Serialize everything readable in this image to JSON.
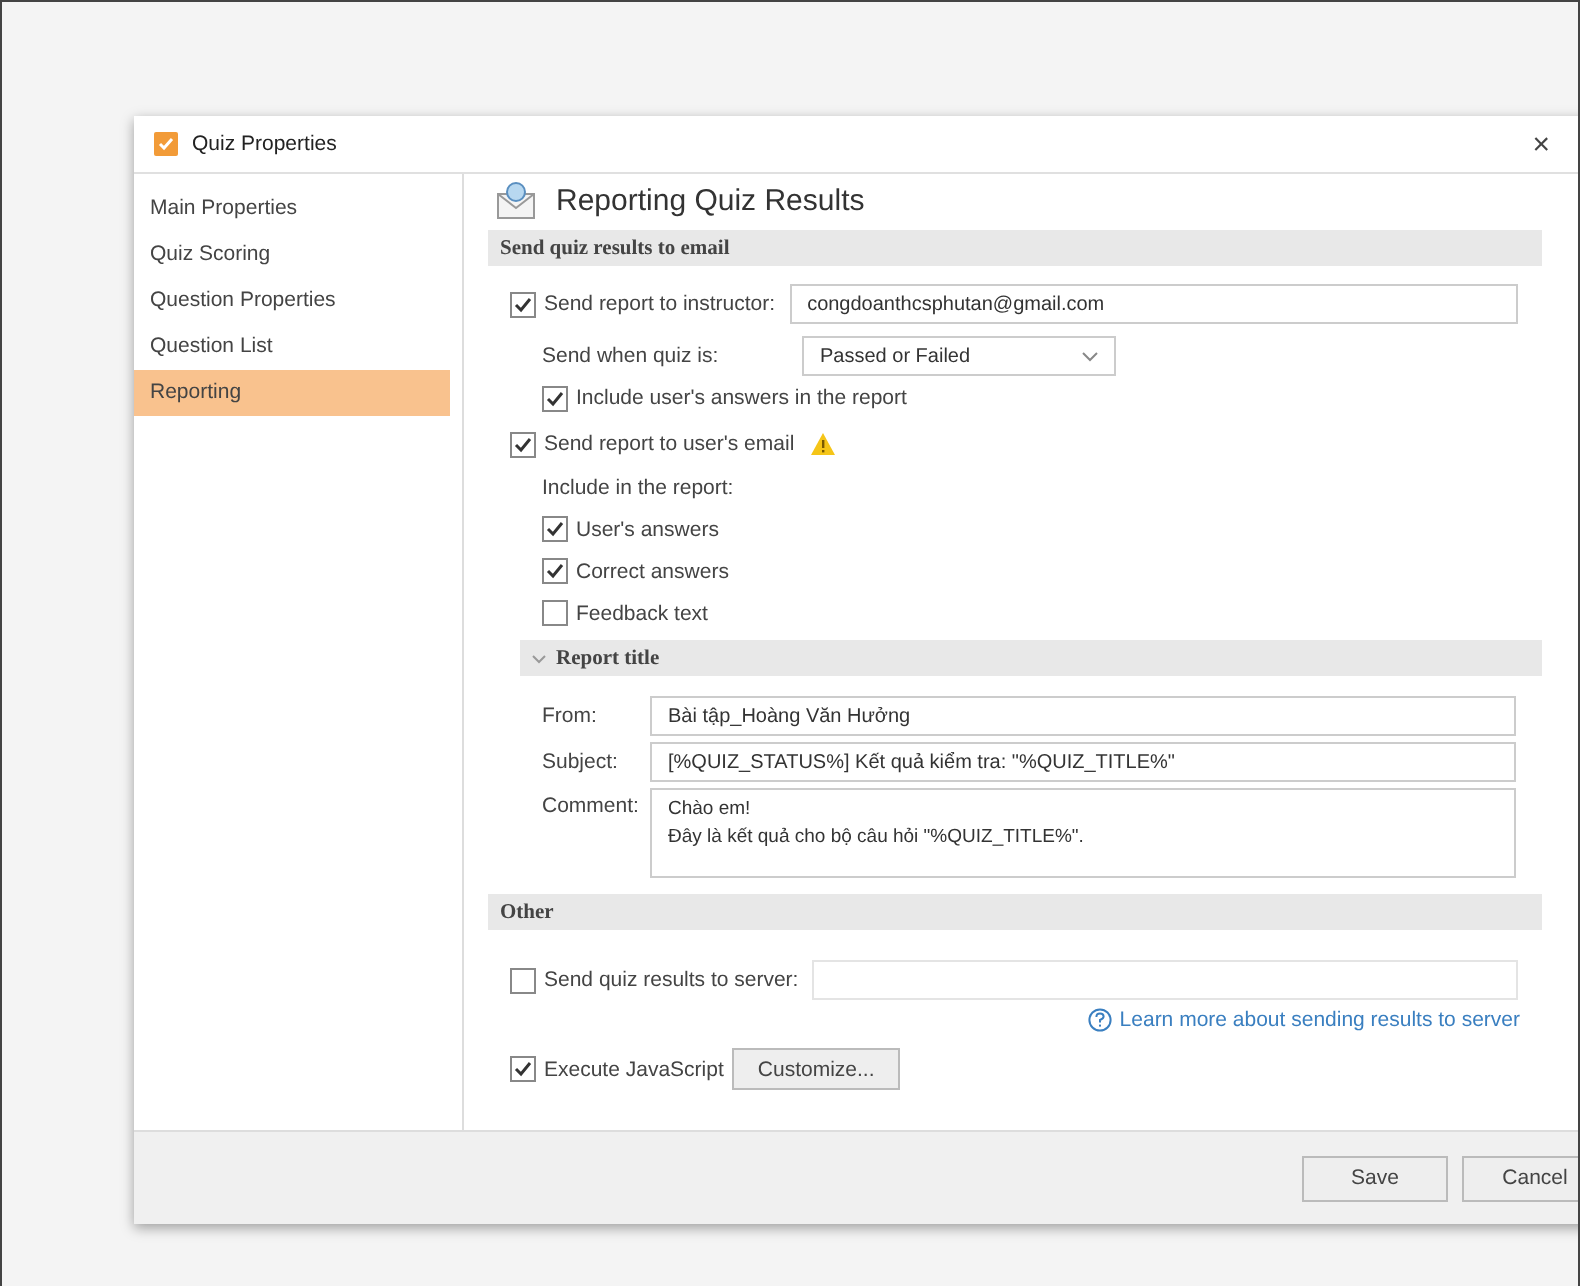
{
  "window": {
    "title": "Quiz Properties",
    "close": "×"
  },
  "sidebar": {
    "items": [
      {
        "label": "Main Properties",
        "selected": false
      },
      {
        "label": "Quiz Scoring",
        "selected": false
      },
      {
        "label": "Question Properties",
        "selected": false
      },
      {
        "label": "Question List",
        "selected": false
      },
      {
        "label": "Reporting",
        "selected": true
      }
    ]
  },
  "page_title": "Reporting Quiz Results",
  "email_section": {
    "header": "Send quiz results to email",
    "instructor": {
      "label": "Send report to instructor:",
      "checked": true,
      "value": "congdoanthcsphutan@gmail.com"
    },
    "send_when": {
      "label": "Send when quiz is:",
      "value": "Passed or Failed"
    },
    "include_answers": {
      "label": "Include user's answers in the report",
      "checked": true
    },
    "user_email": {
      "label": "Send report to user's email",
      "checked": true,
      "warning": true
    },
    "include_label": "Include in the report:",
    "include_items": [
      {
        "label": "User's answers",
        "checked": true
      },
      {
        "label": "Correct answers",
        "checked": true
      },
      {
        "label": "Feedback text",
        "checked": false
      }
    ]
  },
  "report_title": {
    "header": "Report title",
    "expanded": true,
    "from_label": "From:",
    "from": "Bài tập_Hoàng Văn Hưởng",
    "subject_label": "Subject:",
    "subject": "[%QUIZ_STATUS%] Kết quả kiểm tra: \"%QUIZ_TITLE%\"",
    "comment_label": "Comment:",
    "comment": "Chào em!\nĐây là kết quả cho bộ câu hỏi \"%QUIZ_TITLE%\"."
  },
  "other": {
    "header": "Other",
    "server": {
      "label": "Send quiz results to server:",
      "checked": false
    },
    "learn_more": "Learn more about sending results to server",
    "javascript": {
      "label": "Execute JavaScript",
      "checked": true
    },
    "customize": "Customize..."
  },
  "buttons": [
    {
      "label": "Save"
    },
    {
      "label": "Cancel"
    }
  ]
}
